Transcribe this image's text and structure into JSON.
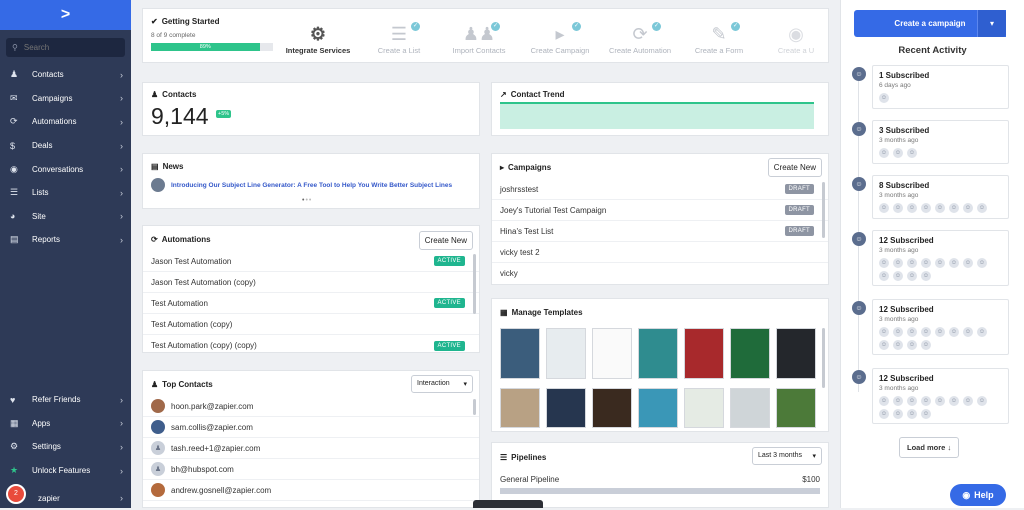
{
  "sidebar": {
    "search_placeholder": "Search",
    "items": [
      {
        "label": "Contacts",
        "icon": "contacts-icon"
      },
      {
        "label": "Campaigns",
        "icon": "envelope-icon"
      },
      {
        "label": "Automations",
        "icon": "automation-icon"
      },
      {
        "label": "Deals",
        "icon": "dollar-icon"
      },
      {
        "label": "Conversations",
        "icon": "chat-icon"
      },
      {
        "label": "Lists",
        "icon": "list-icon"
      },
      {
        "label": "Site",
        "icon": "globe-icon"
      },
      {
        "label": "Reports",
        "icon": "bar-chart-icon"
      }
    ],
    "bottom": [
      {
        "label": "Refer Friends"
      },
      {
        "label": "Apps"
      },
      {
        "label": "Settings"
      },
      {
        "label": "Unlock Features"
      },
      {
        "label": "zapier"
      }
    ],
    "notif_count": "2"
  },
  "getting_started": {
    "title": "Getting Started",
    "progress_text": "8 of 9 complete",
    "progress_pct": "89%",
    "progress": 0.89,
    "steps": [
      "Integrate Services",
      "Create a List",
      "Import Contacts",
      "Create Campaign",
      "Create Automation",
      "Create a Form",
      "Create a U"
    ]
  },
  "contacts": {
    "title": "Contacts",
    "count": "9,144",
    "delta": "+5%"
  },
  "contact_trend": {
    "title": "Contact Trend"
  },
  "news": {
    "title": "News",
    "headline": "Introducing Our Subject Line Generator: A Free Tool to Help You Write Better Subject Lines"
  },
  "campaigns": {
    "title": "Campaigns",
    "create_label": "Create New",
    "rows": [
      {
        "name": "joshrsstest",
        "status": "DRAFT"
      },
      {
        "name": "Joey's Tutorial Test Campaign",
        "status": "DRAFT"
      },
      {
        "name": "Hina's Test List",
        "status": "DRAFT"
      },
      {
        "name": "vicky test 2",
        "status": ""
      },
      {
        "name": "vicky",
        "status": ""
      }
    ]
  },
  "automations": {
    "title": "Automations",
    "create_label": "Create New",
    "rows": [
      {
        "name": "Jason Test Automation",
        "status": "ACTIVE"
      },
      {
        "name": "Jason Test Automation (copy)",
        "status": ""
      },
      {
        "name": "Test Automation",
        "status": "ACTIVE"
      },
      {
        "name": "Test Automation (copy)",
        "status": ""
      },
      {
        "name": "Test Automation (copy) (copy)",
        "status": "ACTIVE"
      }
    ]
  },
  "templates": {
    "title": "Manage Templates"
  },
  "top_contacts": {
    "title": "Top Contacts",
    "sort": "Interaction",
    "rows": [
      "hoon.park@zapier.com",
      "sam.collis@zapier.com",
      "tash.reed+1@zapier.com",
      "bh@hubspot.com",
      "andrew.gosnell@zapier.com"
    ]
  },
  "pipelines": {
    "title": "Pipelines",
    "range": "Last 3 months",
    "rows": [
      {
        "name": "General Pipeline",
        "value": "$100"
      }
    ]
  },
  "right": {
    "create_label": "Create a campaign",
    "recent_title": "Recent Activity",
    "load_more": "Load more",
    "help": "Help",
    "activities": [
      {
        "title": "1 Subscribed",
        "when": "6 days ago",
        "count": 1
      },
      {
        "title": "3 Subscribed",
        "when": "3 months ago",
        "count": 3
      },
      {
        "title": "8 Subscribed",
        "when": "3 months ago",
        "count": 8
      },
      {
        "title": "12 Subscribed",
        "when": "3 months ago",
        "count": 12
      },
      {
        "title": "12 Subscribed",
        "when": "3 months ago",
        "count": 12
      },
      {
        "title": "12 Subscribed",
        "when": "3 months ago",
        "count": 12
      }
    ]
  }
}
